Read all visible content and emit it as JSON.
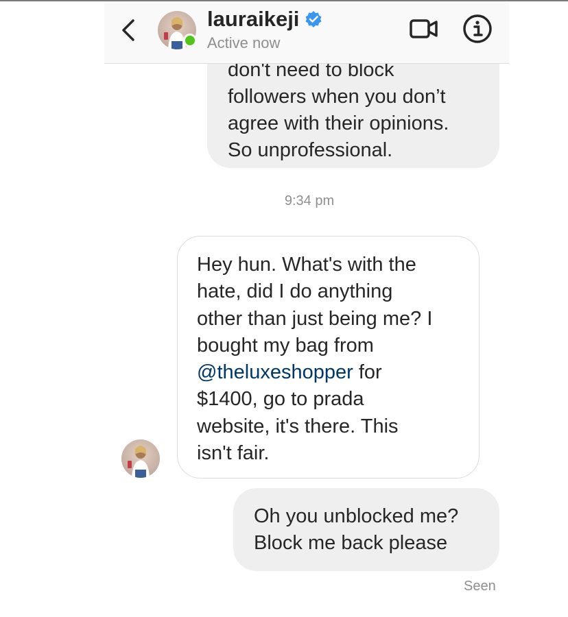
{
  "header": {
    "username": "lauraikeji",
    "status": "Active now",
    "verified": true,
    "status_color": "#52c41a",
    "icons": [
      "back-chevron-icon",
      "verified-badge-icon",
      "video-call-icon",
      "info-icon"
    ]
  },
  "messages": [
    {
      "from": "me",
      "lines": [
        "don't need to block",
        "followers when you don’t",
        "agree with their opinions.",
        "So unprofessional."
      ]
    },
    {
      "timestamp": "9:34 pm"
    },
    {
      "from": "lauraikeji",
      "lines": [
        "Hey hun. What's with the",
        "hate, did I do anything",
        "other than just being me? I",
        "bought my bag from"
      ],
      "mention": "@theluxeshopper",
      "after_mention": " for",
      "lines_after": [
        "$1400, go to prada",
        "website, it's there. This",
        "isn't fair."
      ]
    },
    {
      "from": "me",
      "lines": [
        "Oh you unblocked me?",
        "Block me back please"
      ]
    }
  ],
  "seen_label": "Seen",
  "colors": {
    "bubble_me": "#efefef",
    "mention": "#00376b",
    "muted_text": "#8e8e8e"
  }
}
